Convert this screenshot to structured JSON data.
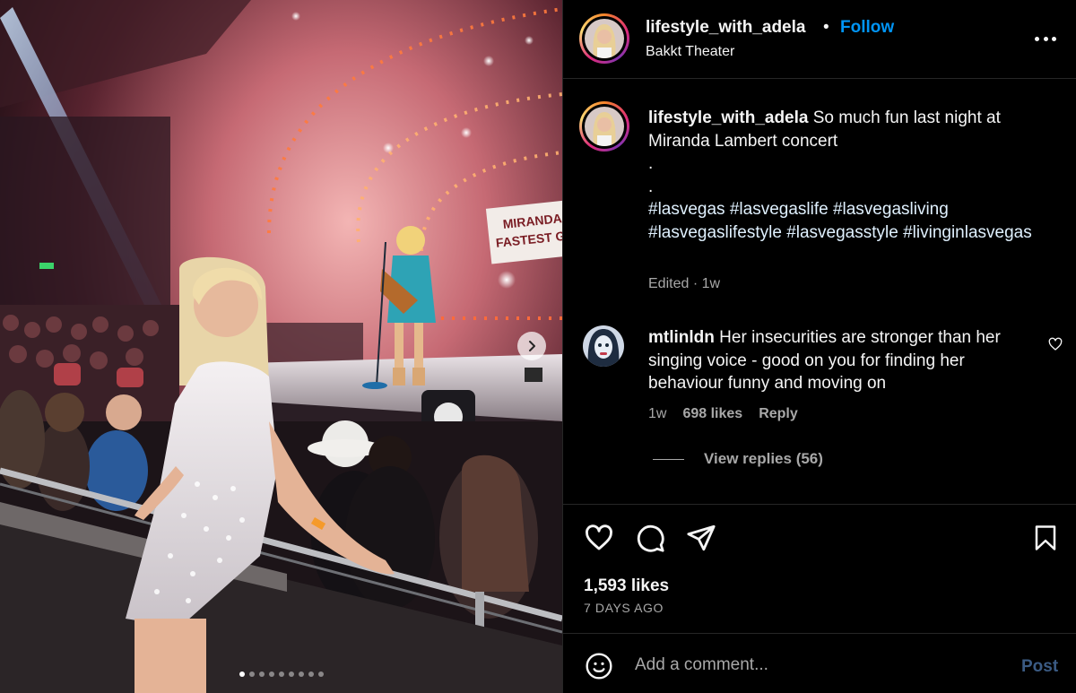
{
  "post": {
    "username": "lifestyle_with_adela",
    "separator": "•",
    "follow_label": "Follow",
    "location": "Bakkt Theater",
    "more_icon": "more-horizontal-icon"
  },
  "media": {
    "stage_banner_line1": "MIRANDA",
    "stage_banner_line2": "FASTEST GI",
    "carousel_count": 9,
    "carousel_active_index": 0
  },
  "caption": {
    "username": "lifestyle_with_adela",
    "text": "So much fun last night at Miranda Lambert concert",
    "dot1": ".",
    "dot2": ".",
    "hashtags": "#lasvegas #lasvegaslife #lasvegasliving #lasvegaslifestyle #lasvegasstyle #livinginlasvegas",
    "meta": "Edited · 1w"
  },
  "comment": {
    "username": "mtlinldn",
    "text": "Her insecurities are stronger than her singing voice - good on you for finding her behaviour funny and moving on",
    "time": "1w",
    "likes": "698 likes",
    "reply_label": "Reply",
    "view_replies": "View replies (56)"
  },
  "actions": {
    "likes": "1,593 likes",
    "date": "7 DAYS AGO"
  },
  "add_comment": {
    "placeholder": "Add a comment...",
    "post_label": "Post"
  },
  "colors": {
    "link_blue": "#0095f6",
    "post_disabled": "#3b5b84",
    "secondary_text": "#a8a8a8",
    "background": "#000000"
  }
}
